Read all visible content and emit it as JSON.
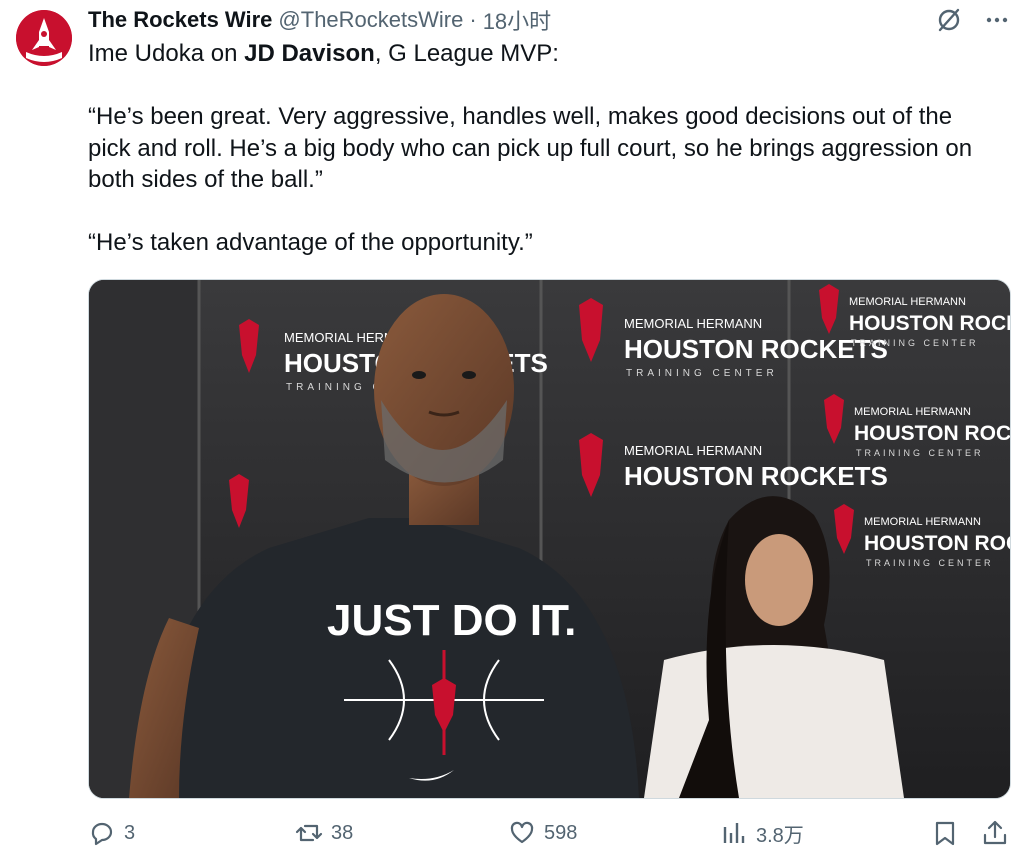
{
  "tweet": {
    "author_name": "The Rockets Wire",
    "author_handle": "@TheRocketsWire",
    "separator": "·",
    "timestamp": "18小时",
    "text_line1_prefix": "Ime Udoka on ",
    "text_line1_bold": "JD Davison",
    "text_line1_suffix": ", G League MVP:",
    "quote1": "“He’s been great. Very aggressive, handles well, makes good decisions out of the pick and roll. He’s a big body who can pick up full court, so he brings aggression on both sides of the ball.”",
    "quote2": "“He’s taken advantage of the opportunity.”"
  },
  "media": {
    "backdrop_line1": "MEMORIAL HERMANN",
    "backdrop_line2": "HOUSTON ROCKETS",
    "backdrop_line3": "TRAINING CENTER",
    "shirt_text": "JUST DO IT."
  },
  "actions": {
    "replies": "3",
    "retweets": "38",
    "likes": "598",
    "views": "3.8万"
  },
  "colors": {
    "rockets_red": "#c8102e",
    "muted_text": "#536471",
    "text": "#0f1419"
  },
  "icons": [
    "avatar-rocket-logo",
    "grok-icon",
    "more-icon",
    "reply-icon",
    "retweet-icon",
    "like-icon",
    "views-icon",
    "bookmark-icon",
    "share-icon"
  ]
}
